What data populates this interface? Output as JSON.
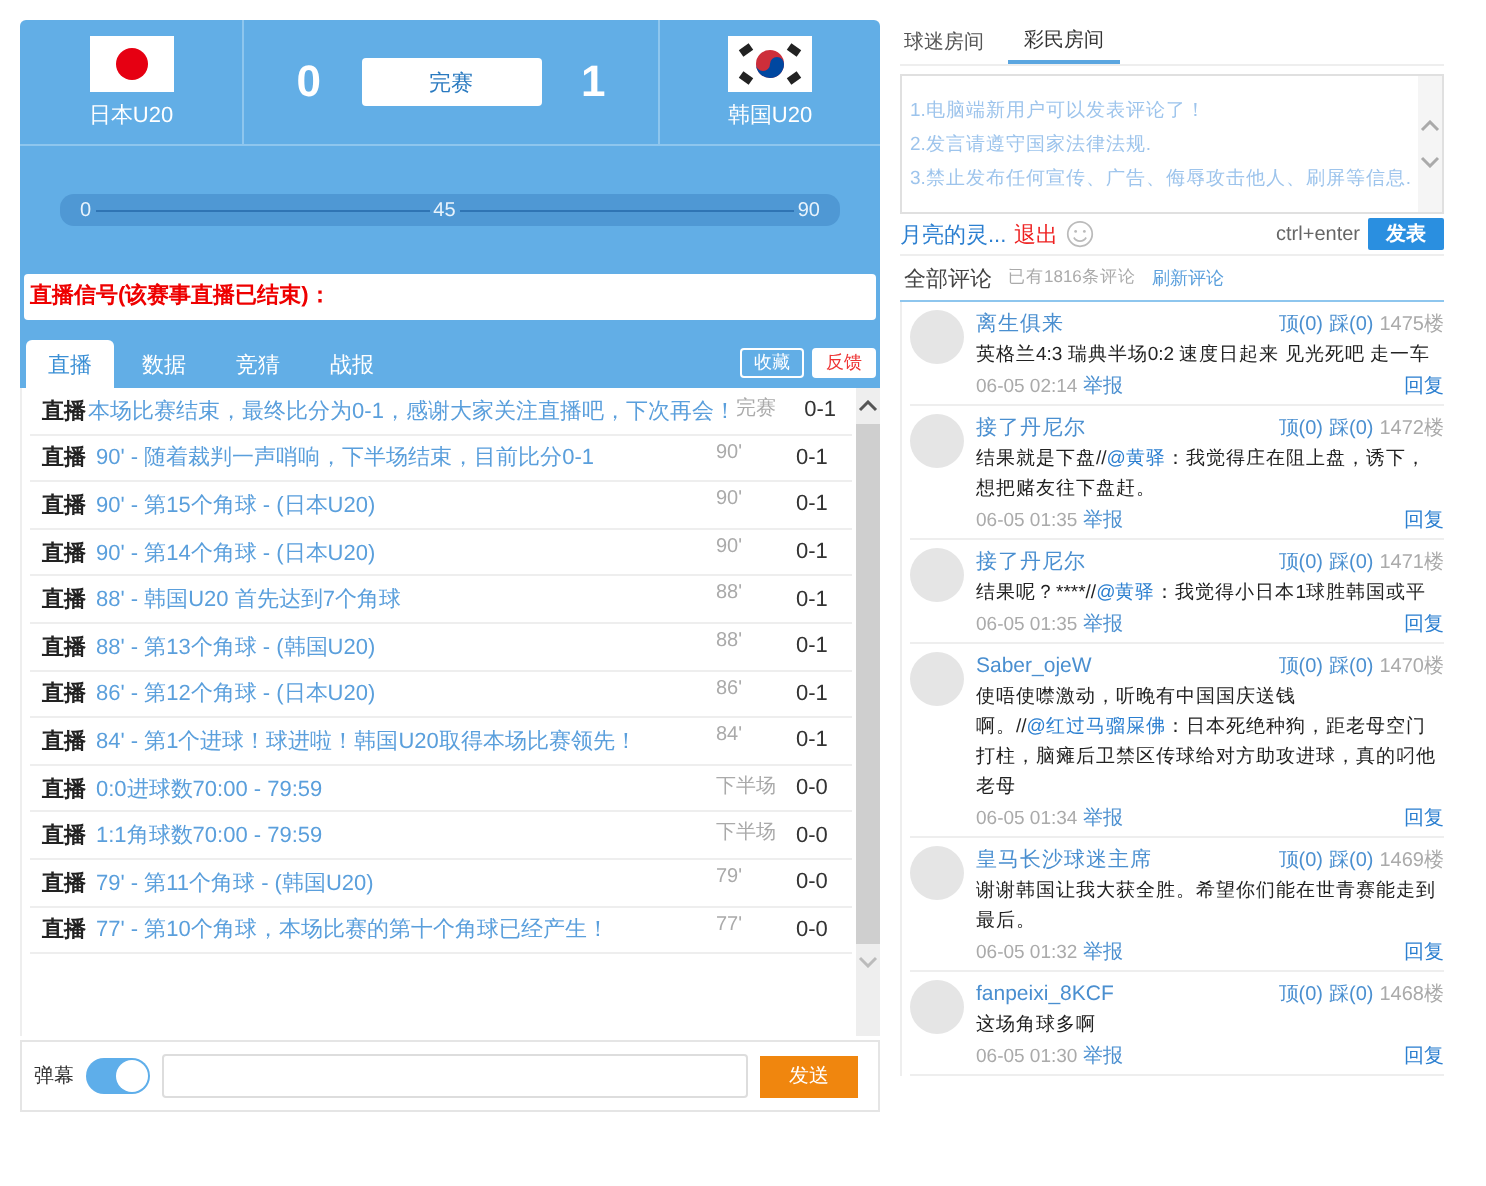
{
  "match": {
    "home": {
      "name": "日本U20",
      "kind": "japan"
    },
    "away": {
      "name": "韩国U20",
      "kind": "korea"
    },
    "home_score": "0",
    "away_score": "1",
    "status": "完赛"
  },
  "timeline": {
    "ticks": [
      "0",
      "45",
      "90"
    ]
  },
  "signal_notice": "直播信号(该赛事直播已结束)：",
  "live_tabs": [
    {
      "label": "直播",
      "selected": true
    },
    {
      "label": "数据",
      "selected": false
    },
    {
      "label": "竞猜",
      "selected": false
    },
    {
      "label": "战报",
      "selected": false
    }
  ],
  "actions": [
    {
      "label": "收藏",
      "kind": "outline"
    },
    {
      "label": "反馈",
      "kind": "alert"
    }
  ],
  "feed": [
    {
      "tag": "直播",
      "text": "本场比赛结束，最终比分为0-1，感谢大家关注直播吧，下次再会！",
      "minute": "完赛",
      "score": "0-1"
    },
    {
      "tag": "直播",
      "text": "90' - 随着裁判一声哨响，下半场结束，目前比分0-1",
      "minute": "90'",
      "score": "0-1"
    },
    {
      "tag": "直播",
      "text": "90' - 第15个角球 - (日本U20)",
      "minute": "90'",
      "score": "0-1"
    },
    {
      "tag": "直播",
      "text": "90' - 第14个角球 - (日本U20)",
      "minute": "90'",
      "score": "0-1"
    },
    {
      "tag": "直播",
      "text": "88' - 韩国U20 首先达到7个角球",
      "minute": "88'",
      "score": "0-1"
    },
    {
      "tag": "直播",
      "text": "88' - 第13个角球 - (韩国U20)",
      "minute": "88'",
      "score": "0-1"
    },
    {
      "tag": "直播",
      "text": "86' - 第12个角球 - (日本U20)",
      "minute": "86'",
      "score": "0-1"
    },
    {
      "tag": "直播",
      "text": "84' - 第1个进球！球进啦！韩国U20取得本场比赛领先！",
      "minute": "84'",
      "score": "0-1"
    },
    {
      "tag": "直播",
      "text": "0:0进球数70:00 - 79:59",
      "minute": "下半场",
      "score": "0-0"
    },
    {
      "tag": "直播",
      "text": "1:1角球数70:00 - 79:59",
      "minute": "下半场",
      "score": "0-0"
    },
    {
      "tag": "直播",
      "text": "79' - 第11个角球 - (韩国U20)",
      "minute": "79'",
      "score": "0-0"
    },
    {
      "tag": "直播",
      "text": "77' - 第10个角球，本场比赛的第十个角球已经产生！",
      "minute": "77'",
      "score": "0-0"
    }
  ],
  "danmaku": {
    "label": "弹幕",
    "on": true
  },
  "send_button": "发送",
  "room_tabs": [
    {
      "label": "球迷房间",
      "selected": false
    },
    {
      "label": "彩民房间",
      "selected": true
    }
  ],
  "notices": [
    "1.电脑端新用户可以发表评论了！",
    "2.发言请遵守国家法律法规.",
    "3.禁止发布任何宣传、广告、侮辱攻击他人、刷屏等信息."
  ],
  "composer": {
    "user": "月亮的灵...",
    "logout": "退出",
    "hint": "ctrl+enter",
    "post_button": "发表"
  },
  "comments_header": {
    "title": "全部评论",
    "count": "已有1816条评论",
    "refresh": "刷新评论"
  },
  "comments": [
    {
      "user": "离生俱来",
      "up": "顶(0)",
      "down": "踩(0)",
      "floor": "1475楼",
      "parts": [
        {
          "kind": "plain",
          "text": "英格兰4:3 瑞典半场0:2 速度日起来 见光死吧 走一车"
        }
      ],
      "time": "06-05 02:14",
      "report": "举报",
      "reply": "回复"
    },
    {
      "user": "接了丹尼尔",
      "up": "顶(0)",
      "down": "踩(0)",
      "floor": "1472楼",
      "parts": [
        {
          "kind": "plain",
          "text": "结果就是下盘//"
        },
        {
          "kind": "mention",
          "text": "@黄驿"
        },
        {
          "kind": "plain",
          "text": "：我觉得庄在阻上盘，诱下，想把赌友往下盘赶。"
        }
      ],
      "time": "06-05 01:35",
      "report": "举报",
      "reply": "回复"
    },
    {
      "user": "接了丹尼尔",
      "up": "顶(0)",
      "down": "踩(0)",
      "floor": "1471楼",
      "parts": [
        {
          "kind": "plain",
          "text": "结果呢？****//"
        },
        {
          "kind": "mention",
          "text": "@黄驿"
        },
        {
          "kind": "plain",
          "text": "：我觉得小日本1球胜韩国或平"
        }
      ],
      "time": "06-05 01:35",
      "report": "举报",
      "reply": "回复"
    },
    {
      "user": "Saber_ojeW",
      "up": "顶(0)",
      "down": "踩(0)",
      "floor": "1470楼",
      "parts": [
        {
          "kind": "plain",
          "text": "使唔使噤激动，听晚有中国国庆送钱啊。//"
        },
        {
          "kind": "mention",
          "text": "@红过马骝屎佛"
        },
        {
          "kind": "plain",
          "text": "：日本死绝种狗，距老母空门打柱，脑瘫后卫禁区传球给对方助攻进球，真的叼他老母"
        }
      ],
      "time": "06-05 01:34",
      "report": "举报",
      "reply": "回复"
    },
    {
      "user": "皇马长沙球迷主席",
      "up": "顶(0)",
      "down": "踩(0)",
      "floor": "1469楼",
      "parts": [
        {
          "kind": "plain",
          "text": "谢谢韩国让我大获全胜。希望你们能在世青赛能走到最后。"
        }
      ],
      "time": "06-05 01:32",
      "report": "举报",
      "reply": "回复"
    },
    {
      "user": "fanpeixi_8KCF",
      "up": "顶(0)",
      "down": "踩(0)",
      "floor": "1468楼",
      "parts": [
        {
          "kind": "plain",
          "text": "这场角球多啊"
        }
      ],
      "time": "06-05 01:30",
      "report": "举报",
      "reply": "回复"
    }
  ]
}
